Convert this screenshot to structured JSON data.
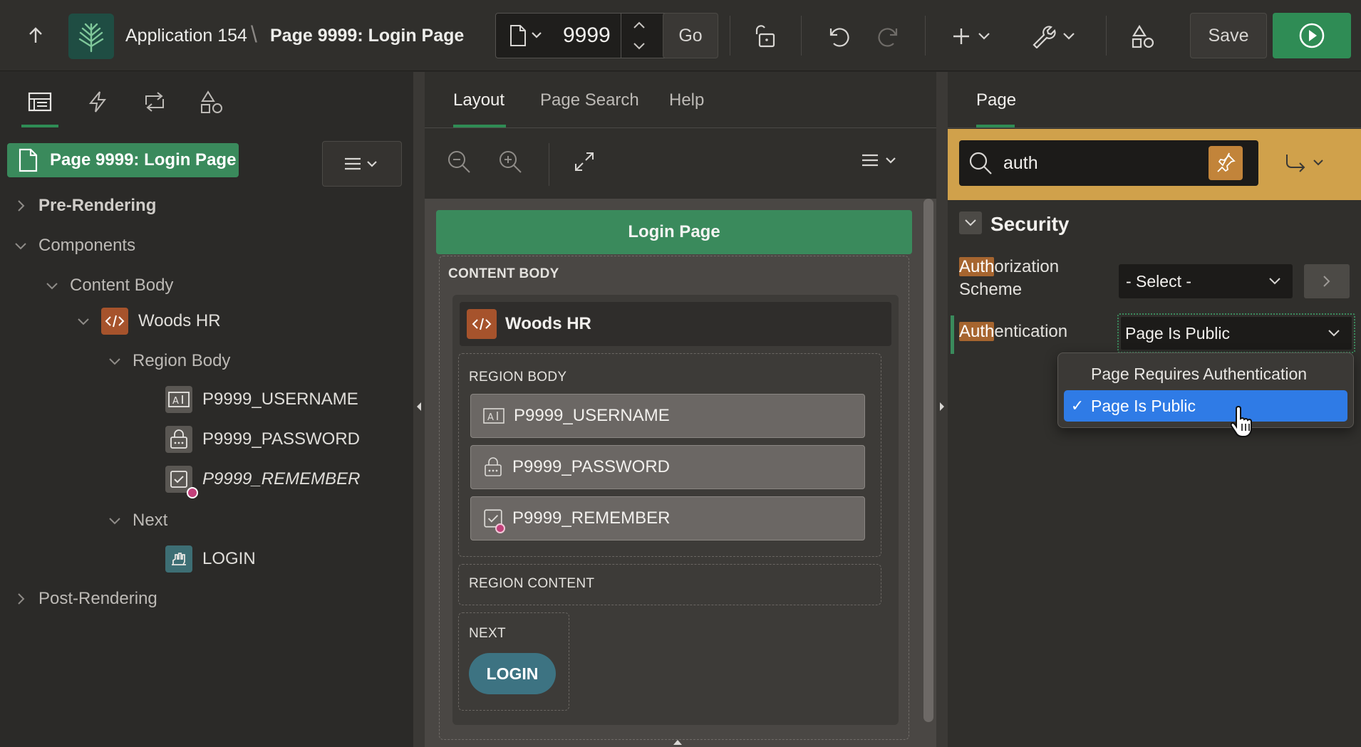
{
  "header": {
    "app_name": "Application 154",
    "breadcrumb_sep": "\\",
    "page_name": "Page 9999: Login Page",
    "page_number": "9999",
    "go_label": "Go",
    "save_label": "Save"
  },
  "left": {
    "page_badge": "Page 9999: Login Page",
    "tree": {
      "pre_rendering": "Pre-Rendering",
      "components": "Components",
      "content_body": "Content Body",
      "woods_hr": "Woods HR",
      "region_body": "Region Body",
      "username": "P9999_USERNAME",
      "password": "P9999_PASSWORD",
      "remember": "P9999_REMEMBER",
      "next": "Next",
      "login": "LOGIN",
      "post_rendering": "Post-Rendering"
    }
  },
  "middle": {
    "tabs": [
      "Layout",
      "Page Search",
      "Help"
    ],
    "login_page_bar": "Login Page",
    "content_body": "CONTENT BODY",
    "woods_hr": "Woods HR",
    "region_body": "REGION BODY",
    "items": [
      "P9999_USERNAME",
      "P9999_PASSWORD",
      "P9999_REMEMBER"
    ],
    "region_content": "REGION CONTENT",
    "next": "NEXT",
    "login_button": "LOGIN"
  },
  "right": {
    "tab": "Page",
    "search_value": "auth",
    "section": "Security",
    "authz": {
      "hl": "Auth",
      "rest_line1": "orization",
      "line2": "Scheme",
      "value": "- Select -"
    },
    "authn": {
      "hl": "Auth",
      "rest": "entication",
      "value": "Page Is Public"
    },
    "dropdown_options": [
      "Page Requires Authentication",
      "Page Is Public"
    ],
    "selected_option": "Page Is Public"
  },
  "colors": {
    "accent_green": "#3a8a5c",
    "highlight_orange": "#a6652f",
    "search_band": "#d0a14b",
    "selection_blue": "#2f7be6",
    "login_button": "#3d7382"
  }
}
